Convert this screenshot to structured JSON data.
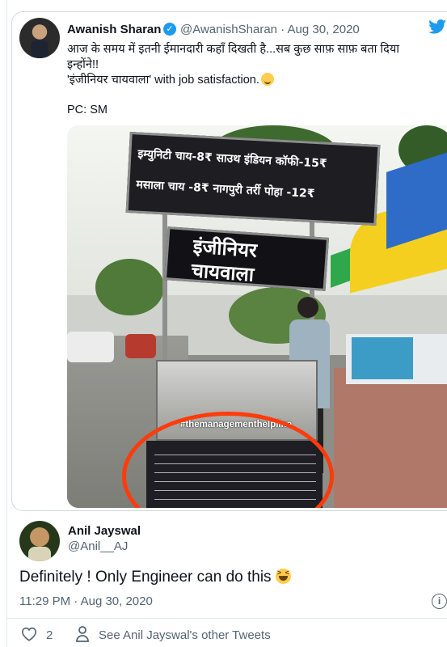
{
  "quoted_tweet": {
    "author_name": "Awanish Sharan",
    "handle_date": "@AwanishSharan · Aug 30, 2020",
    "text_lines": [
      "आज के समय में इतनी ईमानदारी कहाँ दिखती है...सब कुछ साफ़ साफ़ बता दिया",
      "इन्होंने!!",
      "'इंजीनियर चायवाला' with job satisfaction."
    ],
    "photo_credit": "PC: SM",
    "photo": {
      "menu_line_1": "इम्युनिटी चाय-8₹  साउथ इंडियन कॉफी-15₹",
      "menu_line_2": "मसाला चाय -8₹  नागपुरी तर्री पोहा -12₹",
      "sign_line_1": "इंजीनियर",
      "sign_line_2": "चायवाला",
      "hashtag": "#themanagementhelpline"
    }
  },
  "tweet": {
    "author_name": "Anil Jayswal",
    "handle": "@Anil__AJ",
    "text": "Definitely ! Only Engineer can do this",
    "timestamp": "11:29 PM · Aug 30, 2020",
    "like_count": "2",
    "see_more_label": "See Anil Jayswal's other Tweets"
  },
  "colors": {
    "twitter_blue": "#1d9bf0",
    "secondary_text": "#536471",
    "border": "#cfd9de"
  }
}
